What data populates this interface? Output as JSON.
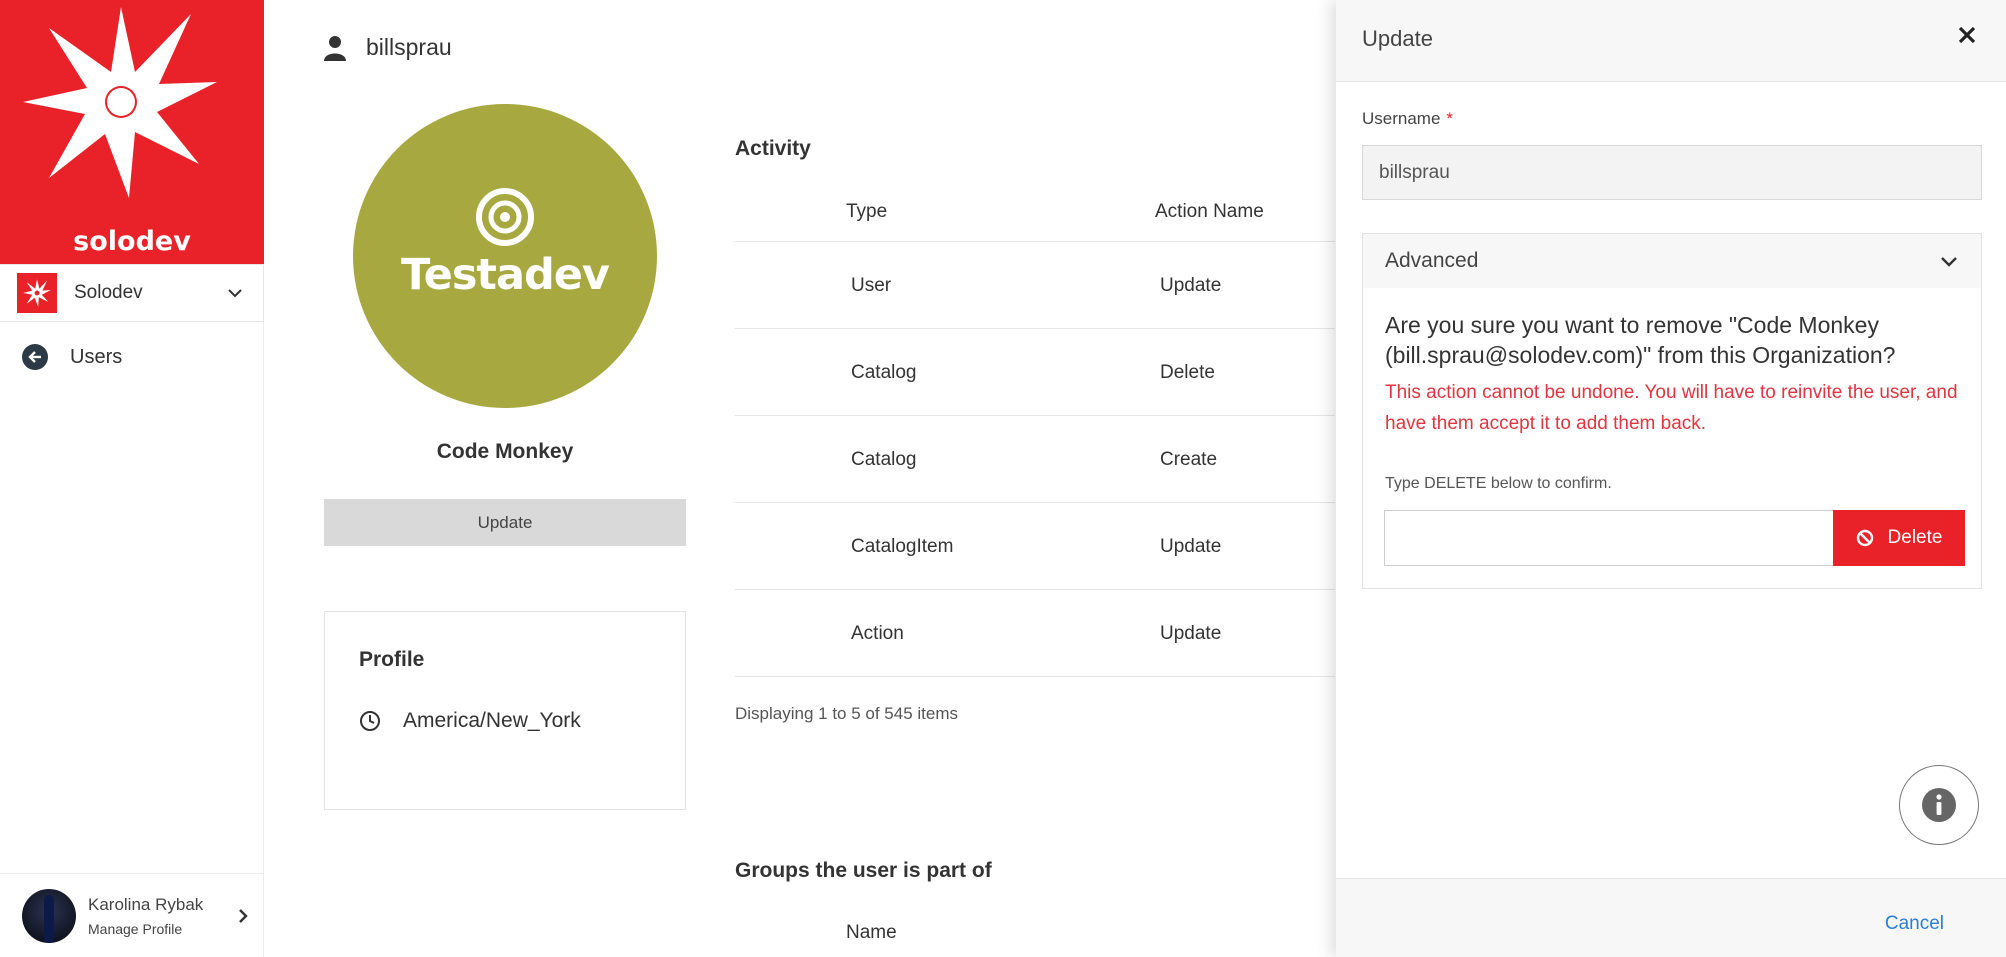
{
  "sidebar": {
    "brand": "solodev",
    "org_name": "Solodev",
    "nav_back_label": "Users",
    "footer": {
      "name": "Karolina Rybak",
      "sub": "Manage Profile"
    }
  },
  "user": {
    "username": "billsprau",
    "avatar_word": "Testadev",
    "display_name": "Code Monkey",
    "update_label": "Update",
    "profile": {
      "title": "Profile",
      "timezone": "America/New_York"
    }
  },
  "activity": {
    "title": "Activity",
    "columns": [
      "Type",
      "Action Name"
    ],
    "rows": [
      {
        "type": "User",
        "action": "Update"
      },
      {
        "type": "Catalog",
        "action": "Delete"
      },
      {
        "type": "Catalog",
        "action": "Create"
      },
      {
        "type": "CatalogItem",
        "action": "Update"
      },
      {
        "type": "Action",
        "action": "Update"
      }
    ],
    "pager": "Displaying 1 to 5 of 545 items"
  },
  "groups": {
    "title": "Groups the user is part of",
    "column": "Name"
  },
  "drawer": {
    "title": "Update",
    "username_label": "Username",
    "required_mark": "*",
    "username_value": "billsprau",
    "advanced_label": "Advanced",
    "confirm_question": "Are you sure you want to remove \"Code Monkey (bill.sprau@solodev.com)\" from this Organization?",
    "warning": "This action cannot be undone. You will have to reinvite the user, and have them accept it to add them back.",
    "hint": "Type DELETE below to confirm.",
    "confirm_input_value": "",
    "delete_label": "Delete",
    "cancel_label": "Cancel"
  },
  "colors": {
    "brand_red": "#e92229",
    "avatar_olive": "#a8a840",
    "link_blue": "#2a7fd4",
    "warning_red": "#e03540"
  },
  "icons": [
    "solodev-logo",
    "chevron-down-icon",
    "back-arrow-icon",
    "user-icon",
    "target-icon",
    "clock-icon",
    "close-icon",
    "ban-icon",
    "info-icon",
    "chevron-right-icon"
  ]
}
